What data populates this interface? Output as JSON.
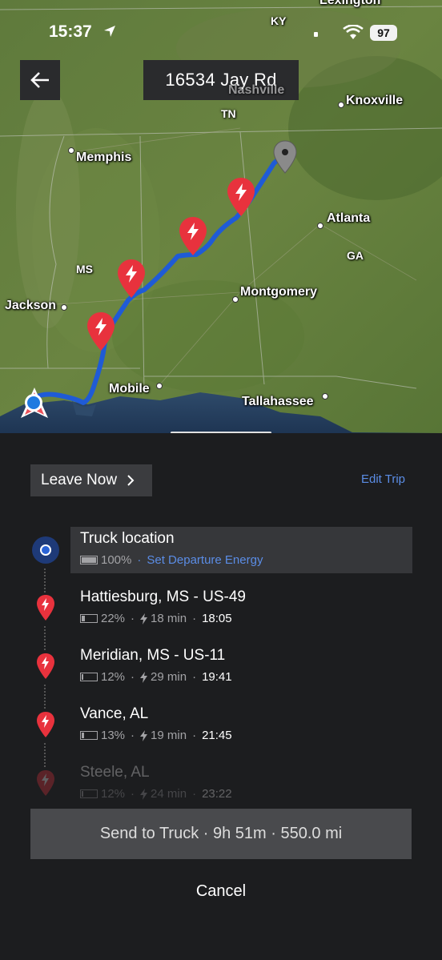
{
  "status_bar": {
    "time": "15:37",
    "battery": "97"
  },
  "header": {
    "title": "16534 Jay Rd"
  },
  "map": {
    "cities": [
      "Lexington",
      "Nashville",
      "Knoxville",
      "Memphis",
      "Atlanta",
      "Montgomery",
      "Jackson",
      "Mobile",
      "Tallahassee"
    ],
    "states": [
      "KY",
      "TN",
      "MS",
      "GA"
    ],
    "route_color": "#1f5bd6",
    "pin_color": "#e8323d"
  },
  "trip": {
    "leave_label": "Leave Now",
    "edit_label": "Edit Trip",
    "origin": {
      "name": "Truck location",
      "energy": "100%",
      "energy_link": "Set Departure Energy"
    },
    "stops": [
      {
        "name": "Hattiesburg, MS - US-49",
        "energy": "22%",
        "charge": "18 min",
        "arrival": "18:05"
      },
      {
        "name": "Meridian, MS - US-11",
        "energy": "12%",
        "charge": "29 min",
        "arrival": "19:41"
      },
      {
        "name": "Vance, AL",
        "energy": "13%",
        "charge": "19 min",
        "arrival": "21:45"
      },
      {
        "name": "Steele, AL",
        "energy": "12%",
        "charge": "24 min",
        "arrival": "23:22"
      }
    ],
    "send_label": "Send to Truck · 9h 51m · 550.0 mi",
    "cancel_label": "Cancel"
  }
}
